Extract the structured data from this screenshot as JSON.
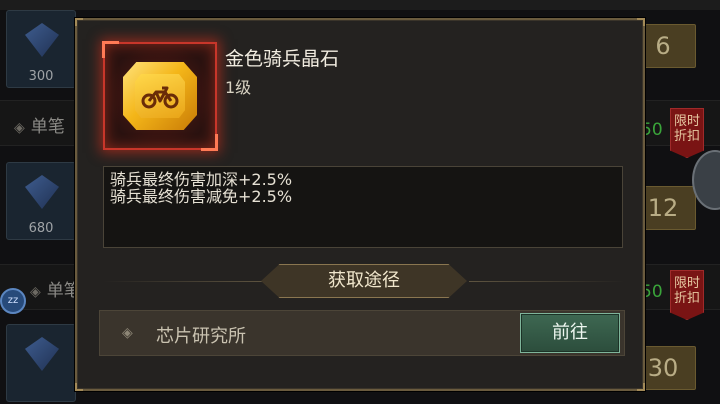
{
  "background": {
    "cards": [
      {
        "amount": "300"
      },
      {
        "amount": "680"
      }
    ],
    "rows": [
      {
        "label": "单笔"
      },
      {
        "label": "单笔"
      }
    ],
    "prices": [
      "6",
      "12",
      "30"
    ],
    "percents": [
      "50",
      "50"
    ],
    "badge": {
      "line1": "限时",
      "line2": "折扣"
    },
    "avatar_label": "zz"
  },
  "popup": {
    "item": {
      "name": "金色骑兵晶石",
      "level": "1级",
      "icon": "motorcycle-gem-icon"
    },
    "description": [
      "骑兵最终伤害加深+2.5%",
      "骑兵最终伤害减免+2.5%"
    ],
    "source_title": "获取途径",
    "sources": [
      {
        "name": "芯片研究所",
        "button_label": "前往"
      }
    ]
  },
  "colors": {
    "rarity_frame": "#c8362a",
    "gem_gold": "#f4b619",
    "go_button": "#3e6852"
  }
}
